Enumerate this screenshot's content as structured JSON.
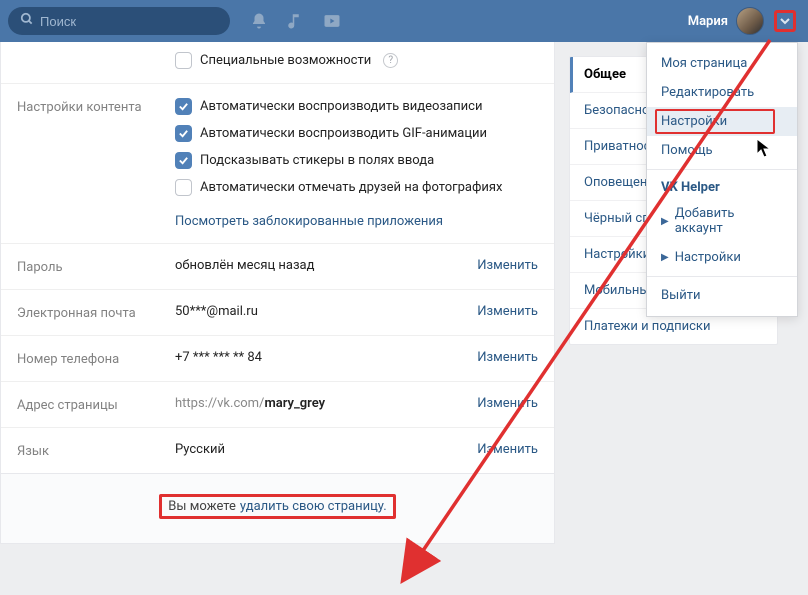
{
  "header": {
    "search_placeholder": "Поиск",
    "user_name": "Мария"
  },
  "dropdown": {
    "items": [
      "Моя страница",
      "Редактировать",
      "Настройки",
      "Помощь"
    ],
    "helper_header": "VK Helper",
    "helper_items": [
      "Добавить аккаунт",
      "Настройки"
    ],
    "logout": "Выйти"
  },
  "sidebar": {
    "items": [
      "Общее",
      "Безопасность",
      "Приватность",
      "Оповещения",
      "Чёрный список",
      "Настройки VK Pay",
      "Мобильные сервисы",
      "Платежи и подписки"
    ]
  },
  "settings": {
    "accessibility": {
      "label": "Специальные возможности"
    },
    "content_label": "Настройки контента",
    "content_checks": [
      "Автоматически воспроизводить видеозаписи",
      "Автоматически воспроизводить GIF-анимации",
      "Подсказывать стикеры в полях ввода",
      "Автоматически отмечать друзей на фотографиях"
    ],
    "blocked_apps": "Посмотреть заблокированные приложения",
    "password": {
      "label": "Пароль",
      "value": "обновлён месяц назад",
      "action": "Изменить"
    },
    "email": {
      "label": "Электронная почта",
      "value": "50***@mail.ru",
      "action": "Изменить"
    },
    "phone": {
      "label": "Номер телефона",
      "value": "+7 *** *** ** 84",
      "action": "Изменить"
    },
    "address": {
      "label": "Адрес страницы",
      "pre": "https://vk.com/",
      "main": "mary_grey",
      "action": "Изменить"
    },
    "language": {
      "label": "Язык",
      "value": "Русский",
      "action": "Изменить"
    },
    "delete_prefix": "Вы можете",
    "delete_link": "удалить свою страницу."
  }
}
